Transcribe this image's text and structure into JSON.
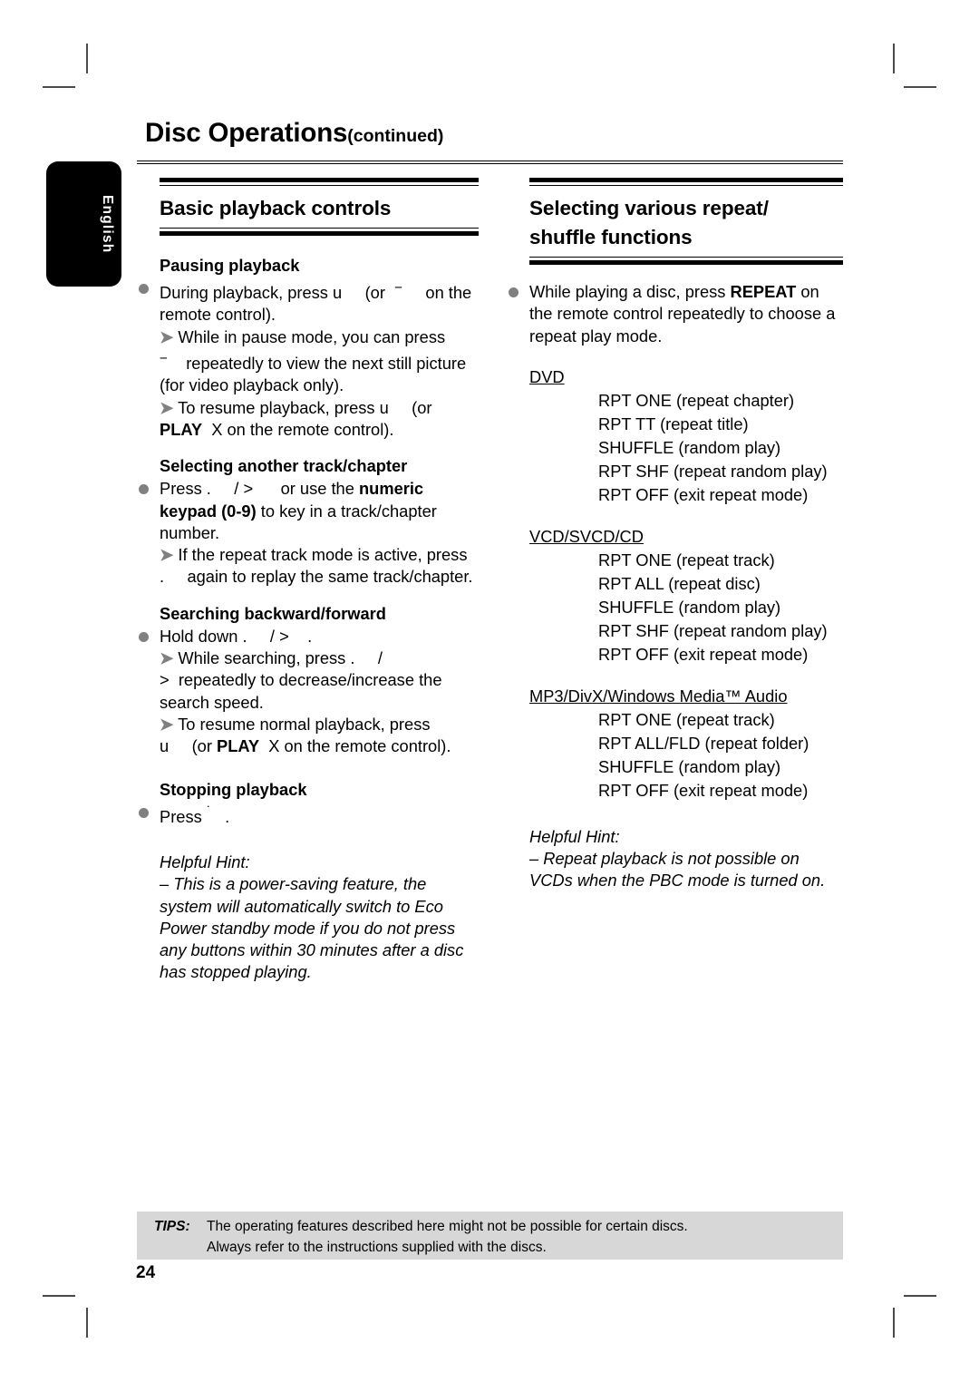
{
  "language_tab": {
    "label": "English"
  },
  "header": {
    "title": "Disc Operations",
    "continued": "(continued)"
  },
  "columns": {
    "left": {
      "title": "Basic playback controls",
      "sections": [
        {
          "heading": "Pausing playback",
          "bullet_line": "During playback, press u      (or  ¯     on the remote control).",
          "arrows": [
            "➜ While in pause mode, you can press ¯    repeatedly to view the next still picture (for video playback only).",
            "➜ To resume playback, press u      (or PLAY  X on the remote control)."
          ]
        },
        {
          "heading": "Selecting another track/chapter",
          "bullet_line": "Press .      / >       or use the numeric keypad (0-9) to key in a track/chapter number.",
          "arrows": [
            "➜ If the repeat track mode is active, press .      again to replay the same track/chapter."
          ]
        },
        {
          "heading": "Searching backward/forward",
          "bullet_line": "Hold down .      / >      .",
          "arrows": [
            "➜ While searching, press .      / >      repeatedly to decrease/increase the search speed.",
            "➜ To resume normal playback, press u      (or PLAY  X on the remote control)."
          ]
        },
        {
          "heading": "Stopping playback",
          "bullet_line": "Press ˙   .",
          "arrows": []
        }
      ],
      "hint_label": "Helpful Hint:",
      "hint_text": "– This is a power-saving feature, the system will automatically switch to Eco Power standby mode if you do not press any buttons within 30 minutes after a disc has stopped playing."
    },
    "right": {
      "title_line1": "Selecting various repeat/",
      "title_line2": "shuffle functions",
      "intro_bullet": "While playing a disc, press REPEAT on the remote control repeatedly to choose a repeat play mode.",
      "format_groups": [
        {
          "format": "DVD",
          "modes": [
            "RPT ONE (repeat chapter)",
            "RPT TT (repeat title)",
            "SHUFFLE (random play)",
            "RPT SHF (repeat random play)",
            "RPT OFF (exit repeat mode)"
          ]
        },
        {
          "format": "VCD/SVCD/CD",
          "modes": [
            "RPT ONE (repeat track)",
            "RPT ALL (repeat disc)",
            "SHUFFLE (random play)",
            "RPT SHF (repeat random play)",
            "RPT OFF (exit repeat mode)"
          ]
        },
        {
          "format": "MP3/DivX/Windows Media™ Audio",
          "modes": [
            "RPT ONE (repeat track)",
            "RPT ALL/FLD (repeat folder)",
            "SHUFFLE (random play)",
            "RPT OFF (exit repeat mode)"
          ]
        }
      ],
      "hint_label": "Helpful Hint:",
      "hint_text": "– Repeat playback is not possible on VCDs when the PBC mode is turned on."
    }
  },
  "tips": {
    "label": "TIPS:",
    "line1": "The operating features described here might not be possible for certain discs.",
    "line2": "Always refer to the instructions supplied with the discs."
  },
  "page_number": "24"
}
